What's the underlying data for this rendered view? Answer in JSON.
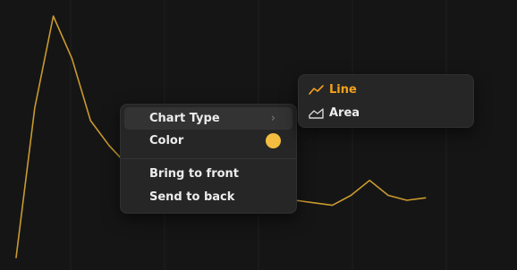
{
  "chart": {
    "series_color": "#c99a2e",
    "values": [
      -5,
      55,
      92,
      75,
      50,
      40,
      32,
      28,
      24,
      22,
      30,
      22,
      28,
      20,
      20,
      18,
      17,
      16,
      20,
      26,
      20,
      18,
      19
    ]
  },
  "context_menu": {
    "items": [
      {
        "label": "Chart Type",
        "has_submenu": true,
        "chevron": "›"
      },
      {
        "label": "Color",
        "swatch": "#f3bd3f"
      },
      {
        "label": "Bring to front"
      },
      {
        "label": "Send to back"
      }
    ]
  },
  "submenu": {
    "items": [
      {
        "label": "Line",
        "icon": "line-chart-icon",
        "selected": true,
        "color": "#f5a11c"
      },
      {
        "label": "Area",
        "icon": "area-chart-icon",
        "selected": false
      }
    ]
  }
}
